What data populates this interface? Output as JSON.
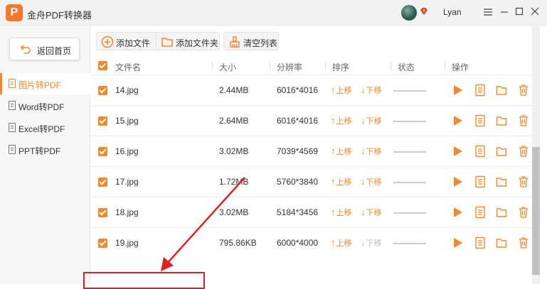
{
  "app": {
    "title": "金舟PDF转换器",
    "logo_char": "P",
    "username": "Lyan"
  },
  "window": {
    "menu_icon": "menu-icon",
    "min_icon": "minimize-icon",
    "max_icon": "maximize-icon",
    "close_icon": "close-icon"
  },
  "sidebar": {
    "home_label": "返回首页",
    "items": [
      {
        "label": "图片转PDF",
        "active": true
      },
      {
        "label": "Word转PDF",
        "active": false
      },
      {
        "label": "Excel转PDF",
        "active": false
      },
      {
        "label": "PPT转PDF",
        "active": false
      }
    ]
  },
  "toolbar": {
    "add_file": "添加文件",
    "add_folder": "添加文件夹",
    "clear_list": "清空列表"
  },
  "table": {
    "headers": {
      "name": "文件名",
      "size": "大小",
      "resolution": "分辨率",
      "sort": "排序",
      "status": "状态",
      "action": "操作"
    },
    "move_up": "上移",
    "move_down": "下移",
    "rows": [
      {
        "name": "14.jpg",
        "size": "2.44MB",
        "resolution": "6016*4016",
        "checked": true,
        "down_enabled": true
      },
      {
        "name": "15.jpg",
        "size": "2.64MB",
        "resolution": "6016*4016",
        "checked": true,
        "down_enabled": true
      },
      {
        "name": "16.jpg",
        "size": "3.02MB",
        "resolution": "7039*4569",
        "checked": true,
        "down_enabled": true
      },
      {
        "name": "17.jpg",
        "size": "1.72MB",
        "resolution": "5760*3840",
        "checked": true,
        "down_enabled": true
      },
      {
        "name": "18.jpg",
        "size": "3.02MB",
        "resolution": "5184*3456",
        "checked": true,
        "down_enabled": true
      },
      {
        "name": "19.jpg",
        "size": "795.86KB",
        "resolution": "6000*4000",
        "checked": true,
        "down_enabled": false
      }
    ]
  },
  "colors": {
    "accent": "#f5882a",
    "annotation": "#e02020"
  }
}
